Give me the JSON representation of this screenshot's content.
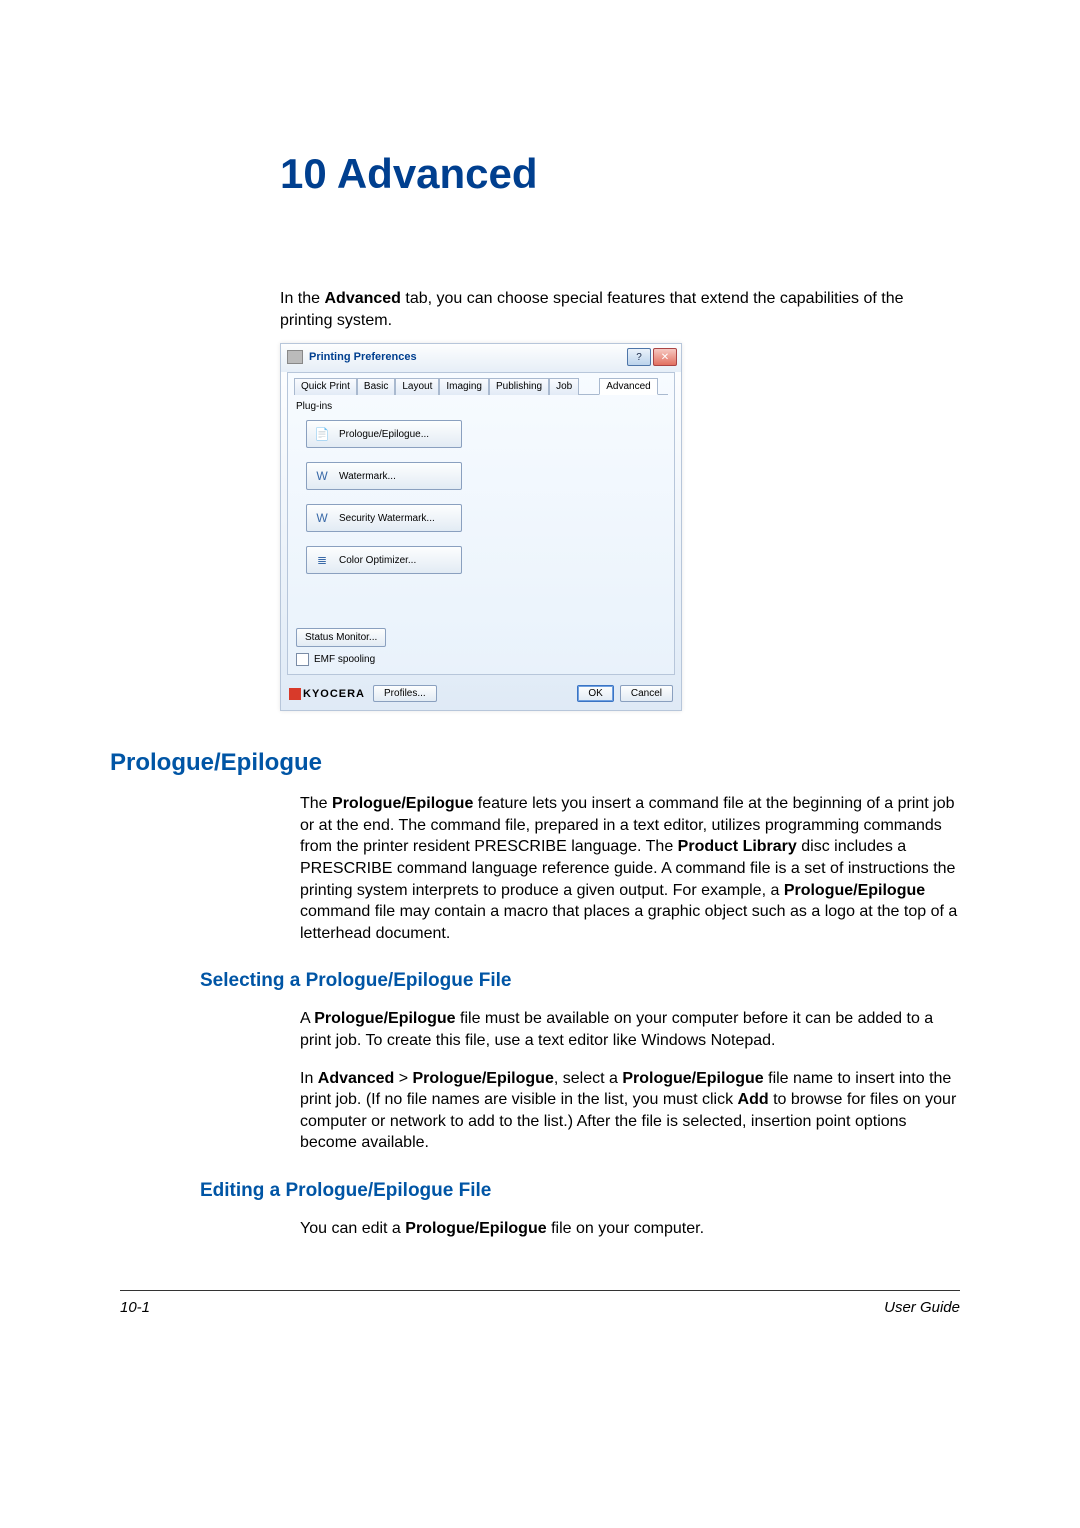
{
  "chapter_title": "10 Advanced",
  "intro": {
    "pre": "In the ",
    "bold": "Advanced",
    "post": " tab, you can choose special features that extend the capabilities of the printing system."
  },
  "dialog": {
    "title": "Printing Preferences",
    "help_btn": "?",
    "close_btn": "✕",
    "tabs": [
      "Quick Print",
      "Basic",
      "Layout",
      "Imaging",
      "Publishing",
      "Job",
      "Advanced"
    ],
    "active_tab_index": 6,
    "plugins_label": "Plug-ins",
    "plugins": [
      {
        "label": "Prologue/Epilogue...",
        "icon": "📄"
      },
      {
        "label": "Watermark...",
        "icon": "W"
      },
      {
        "label": "Security Watermark...",
        "icon": "W"
      },
      {
        "label": "Color Optimizer...",
        "icon": "≣"
      }
    ],
    "status_monitor": "Status Monitor...",
    "emf_label": "EMF spooling",
    "logo": "KYOCERA",
    "profiles_btn": "Profiles...",
    "ok_btn": "OK",
    "cancel_btn": "Cancel"
  },
  "h2_prologue": "Prologue/Epilogue",
  "prologue_para": {
    "t1": "The ",
    "b1": "Prologue/Epilogue",
    "t2": " feature lets you insert a command file at the beginning of a print job or at the end. The command file, prepared in a text editor, utilizes programming commands from the printer resident PRESCRIBE language. The ",
    "b2": "Product Library",
    "t3": " disc includes a PRESCRIBE command language reference guide. A command file is a set of instructions the printing system interprets to produce a given output. For example, a ",
    "b3": "Prologue/Epilogue",
    "t4": " command file may contain a macro that places a graphic object such as a logo at the top of a letterhead document."
  },
  "h3_selecting": "Selecting a Prologue/Epilogue File",
  "selecting_p1": {
    "t1": "A ",
    "b1": "Prologue/Epilogue",
    "t2": " file must be available on your computer before it can be added to a print job. To create this file, use a text editor like Windows Notepad."
  },
  "selecting_p2": {
    "t1": "In ",
    "b1": "Advanced",
    "t2": " > ",
    "b2": "Prologue/Epilogue",
    "t3": ", select a ",
    "b3": "Prologue/Epilogue",
    "t4": " file name to insert into the print job. (If no file names are visible in the list, you must click ",
    "b4": "Add",
    "t5": " to browse for files on your computer or network to add to the list.) After the file is selected, insertion point options become available."
  },
  "h3_editing": "Editing a Prologue/Epilogue File",
  "editing_p1": {
    "t1": "You can edit a ",
    "b1": "Prologue/Epilogue",
    "t2": " file on your computer."
  },
  "footer": {
    "page": "10-1",
    "guide": "User Guide"
  }
}
